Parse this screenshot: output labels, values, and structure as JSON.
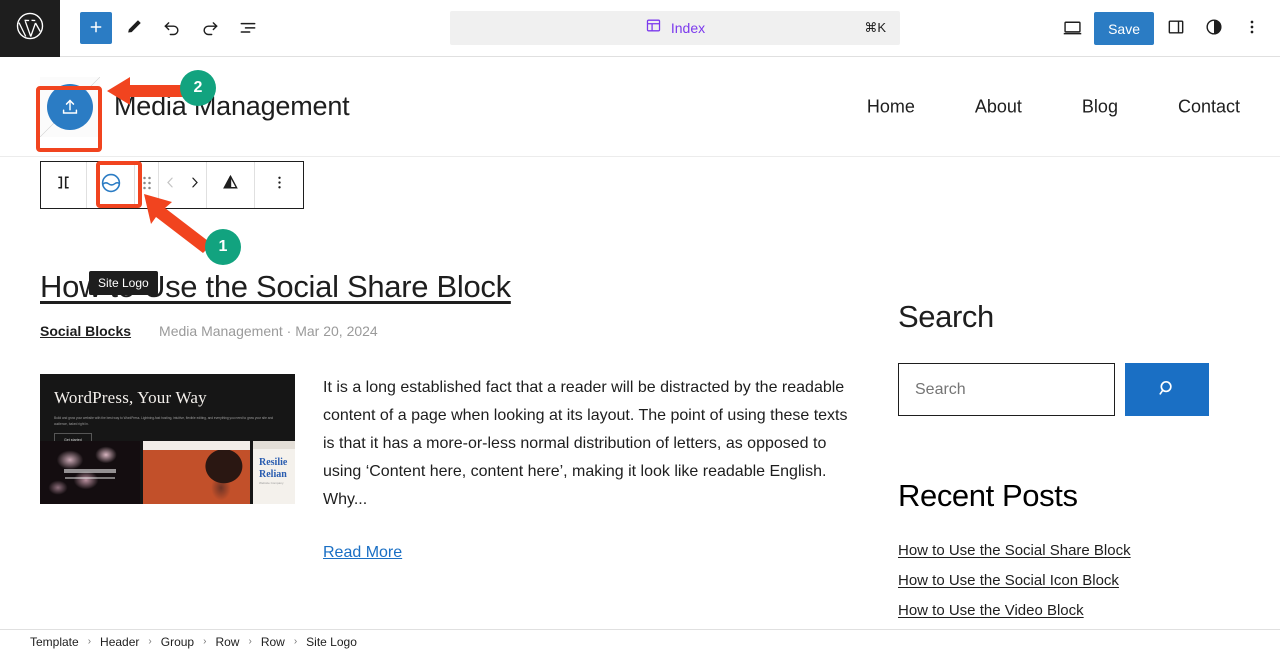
{
  "topbar": {
    "wp_logo_icon": "wordpress-logo-icon",
    "add_block_label": "+",
    "tools": [
      {
        "name": "add-block-button",
        "icon": "plus-icon"
      },
      {
        "name": "edit-tool-button",
        "icon": "pencil-icon"
      },
      {
        "name": "undo-button",
        "icon": "undo-arrow-icon"
      },
      {
        "name": "redo-button",
        "icon": "redo-arrow-icon"
      },
      {
        "name": "list-view-button",
        "icon": "list-view-icon"
      }
    ],
    "command_center": {
      "label": "Index",
      "shortcut": "⌘K",
      "icon": "template-index-icon",
      "accent": "#7c3aed"
    },
    "view_button_icon": "desktop-view-icon",
    "save_label": "Save",
    "settings_icon": "sidebar-settings-icon",
    "styles_icon": "styles-contrast-icon",
    "options_icon": "more-options-vertical-icon"
  },
  "site_header": {
    "logo_placeholder_icon": "upload-site-logo-icon",
    "site_title": "Media Management",
    "nav": [
      {
        "label": "Home"
      },
      {
        "label": "About"
      },
      {
        "label": "Blog"
      },
      {
        "label": "Contact"
      }
    ]
  },
  "block_toolbar": {
    "items": [
      {
        "name": "select-parent-row-button",
        "icon": "row-block-icon"
      },
      {
        "name": "site-logo-block-button",
        "icon": "site-logo-icon"
      },
      {
        "name": "drag-handle",
        "icon": "drag-dots-icon"
      },
      {
        "name": "move-up-button",
        "icon": "chevron-left-icon"
      },
      {
        "name": "move-down-button",
        "icon": "chevron-right-icon"
      },
      {
        "name": "align-button",
        "icon": "align-triangle-icon"
      },
      {
        "name": "more-options-button",
        "icon": "more-options-vertical-icon"
      }
    ],
    "tooltip": "Site Logo"
  },
  "post": {
    "title": "How to Use the Social Share Block",
    "category": "Social Blocks",
    "author_and_date": "Media Management · Mar 20, 2024",
    "thumbnail": {
      "headline": "WordPress, Your Way",
      "subtext": "Build and grow your website with the best way to WordPress. Lightning-fast hosting, intuitive, flexible editing, and everything you need to grow your site and audience, baked right in.",
      "button_label": "Get started"
    },
    "excerpt": "It is a long established fact that a reader will be distracted by the readable content of a page when looking at its layout. The point of using these texts is that it has a more-or-less normal distribution of letters, as opposed to using ‘Content here, content here’, making it look like readable English. Why...",
    "read_more_label": "Read More",
    "strip_text": "Resilie Relian",
    "strip_sub": "Website Company"
  },
  "sidebar": {
    "search_heading": "Search",
    "search_placeholder": "Search",
    "search_button_icon": "search-magnifier-icon",
    "recent_heading": "Recent Posts",
    "recent_posts": [
      {
        "label": "How to Use the Social Share Block"
      },
      {
        "label": "How to Use the Social Icon Block"
      },
      {
        "label": "How to Use the Video Block"
      }
    ]
  },
  "breadcrumb": {
    "items": [
      {
        "label": "Template"
      },
      {
        "label": "Header"
      },
      {
        "label": "Group"
      },
      {
        "label": "Row"
      },
      {
        "label": "Row"
      },
      {
        "label": "Site Logo"
      }
    ],
    "separator": "›"
  },
  "annotations": {
    "badge_1": "1",
    "badge_2": "2",
    "highlight_color": "#f1441f",
    "badge_color": "#12a37f"
  }
}
